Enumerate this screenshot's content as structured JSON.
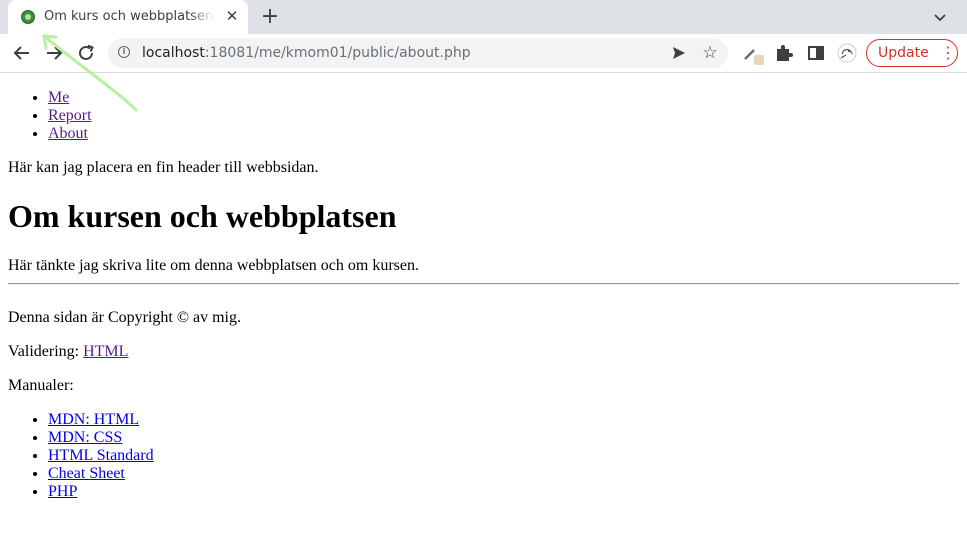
{
  "browser": {
    "tab_title": "Om kurs och webbplatsen | Min me-sida",
    "url_host": "localhost",
    "url_rest": ":18081/me/kmom01/public/about.php",
    "update_label": "Update",
    "accent_update": "#d93025"
  },
  "nav": {
    "items": [
      "Me",
      "Report",
      "About"
    ]
  },
  "header_text": "Här kan jag placera en fin header till webbsidan.",
  "main": {
    "title": "Om kursen och webbplatsen",
    "intro": "Här tänkte jag skriva lite om denna webbplatsen och om kursen."
  },
  "footer": {
    "copyright": "Denna sidan är Copyright © av mig.",
    "validation_label": "Validering:",
    "validation_link": "HTML",
    "manuals_label": "Manualer:",
    "manuals": [
      "MDN: HTML",
      "MDN: CSS",
      "HTML Standard",
      "Cheat Sheet",
      "PHP"
    ]
  }
}
